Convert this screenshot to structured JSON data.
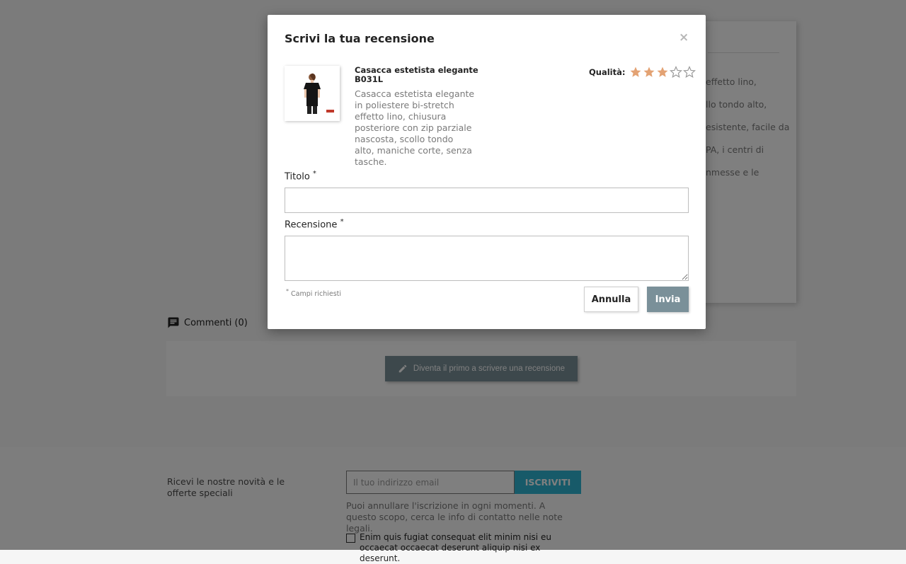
{
  "background": {
    "product_description_fragment": [
      "effetto lino,",
      "llo tondo alto,",
      "esistente, facile da",
      "PA, i centri di",
      "nmesse e le"
    ],
    "comments": {
      "title": "Commenti (0)",
      "first_review_button": "Diventa il primo a scrivere una recensione"
    },
    "newsletter": {
      "text": "Ricevi le nostre novità e le offerte speciali",
      "email_placeholder": "Il tuo indirizzo email",
      "subscribe_label": "ISCRIVITI",
      "unsubscribe_note": "Puoi annullare l'iscrizione in ogni momenti. A questo scopo, cerca le info di contatto nelle note legali.",
      "consent_text": "Enim quis fugiat consequat elit minim nisi eu occaecat occaecat deserunt aliquip nisi ex deserunt."
    },
    "colors": {
      "overlay": "#000000",
      "button_primary": "#7a9099",
      "newsletter_accent": "#2fb5d2"
    }
  },
  "modal": {
    "title": "Scrivi la tua recensione",
    "close_symbol": "×",
    "product": {
      "name": "Casacca estetista elegante B031L",
      "description": "Casacca estetista elegante in poliestere bi-stretch effetto lino, chiusura posteriore con zip parziale nascosta, scollo tondo alto, maniche corte, senza tasche.",
      "image_alt": "Casacca estetista elegante B031L"
    },
    "rating": {
      "label": "Qualità:",
      "value": 3,
      "max": 5,
      "filled_color": "#e3a273",
      "empty_color": "#9a9a9a"
    },
    "fields": {
      "title_label": "Titolo",
      "review_label": "Recensione",
      "required_marker": "*",
      "title_value": "",
      "review_value": ""
    },
    "required_note": "Campi richiesti",
    "cancel_label": "Annulla",
    "send_label": "Invia"
  }
}
